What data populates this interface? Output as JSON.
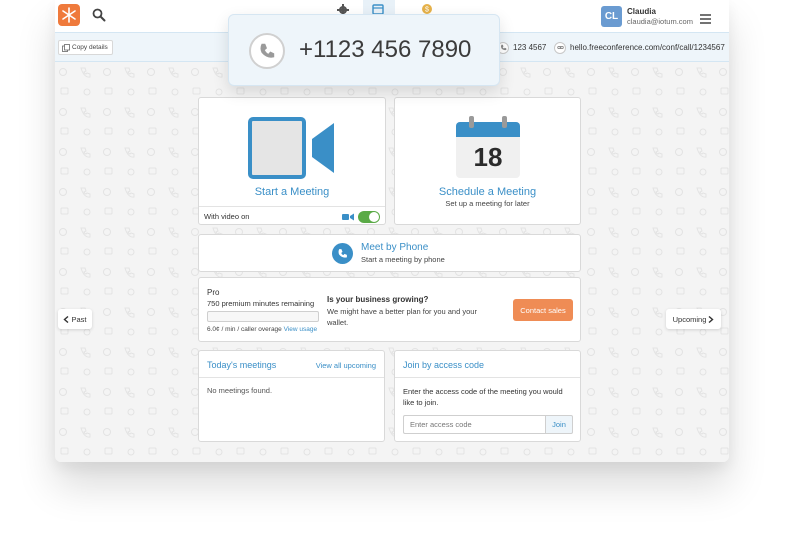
{
  "topbar": {
    "user": {
      "initials": "CL",
      "name": "Claudia",
      "email": "claudia@iotum.com"
    }
  },
  "infobar": {
    "copy_label": "Copy details",
    "access_code": "123 4567",
    "url": "hello.freeconference.com/conf/call/1234567"
  },
  "popup": {
    "phone_number": "+1123 456 7890"
  },
  "start_meeting": {
    "title": "Start a Meeting",
    "video_label": "With video on",
    "video_on": true
  },
  "schedule_meeting": {
    "title": "Schedule a Meeting",
    "subtitle": "Set up a meeting for later",
    "calendar_day": "18"
  },
  "meet_by_phone": {
    "title": "Meet by Phone",
    "subtitle": "Start a meeting by phone"
  },
  "plan": {
    "name": "Pro",
    "minutes_remaining": "750 premium minutes remaining",
    "rate": "6.0¢ / min / caller overage",
    "view_usage": "View usage",
    "grow_title": "Is your business growing?",
    "grow_text": "We might have a better plan for you and your wallet.",
    "contact_label": "Contact sales",
    "usage_fraction": 0.0
  },
  "nav": {
    "past_label": "Past",
    "upcoming_label": "Upcoming"
  },
  "today": {
    "title": "Today's meetings",
    "view_all": "View all upcoming",
    "empty_text": "No meetings found."
  },
  "join": {
    "title": "Join by access code",
    "instructions": "Enter the access code of the meeting you would like to join.",
    "placeholder": "Enter access code",
    "button_label": "Join"
  },
  "colors": {
    "accent": "#3a8fc7",
    "brand": "#ef7a3c",
    "toggle_on": "#5aaa46"
  }
}
